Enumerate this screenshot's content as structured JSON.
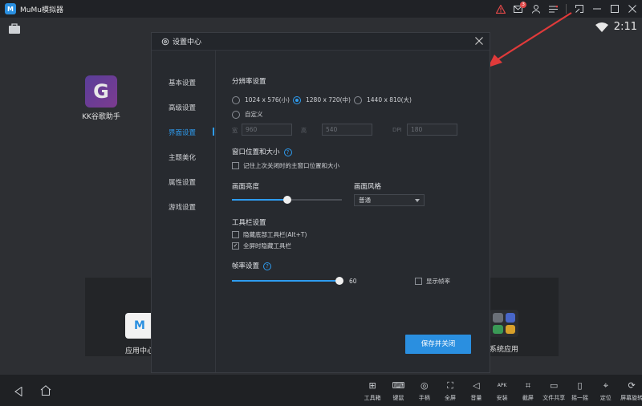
{
  "window": {
    "title": "MuMu模拟器",
    "logo_text": "M",
    "notification_count": "3"
  },
  "statusbar": {
    "time": "2:11"
  },
  "desktop": {
    "kk_app": {
      "label": "KK谷歌助手",
      "icon_letter": "G"
    },
    "app_center": {
      "label": "应用中心",
      "icon_letter": "M"
    },
    "system_apps": {
      "label": "系统应用"
    }
  },
  "bottom_tools": [
    {
      "icon": "toolbox-icon",
      "glyph": "⊞",
      "label": "工具箱"
    },
    {
      "icon": "keyboard-icon",
      "glyph": "⌨",
      "label": "键鼠"
    },
    {
      "icon": "gamepad-icon",
      "glyph": "◎",
      "label": "手柄"
    },
    {
      "icon": "fullscreen-icon",
      "glyph": "⛶",
      "label": "全屏"
    },
    {
      "icon": "volume-icon",
      "glyph": "◁",
      "label": "音量"
    },
    {
      "icon": "apk-install-icon",
      "glyph": "APK",
      "label": "安装"
    },
    {
      "icon": "crop-screenshot-icon",
      "glyph": "⌗",
      "label": "截屏"
    },
    {
      "icon": "folder-share-icon",
      "glyph": "▭",
      "label": "文件共享"
    },
    {
      "icon": "shake-icon",
      "glyph": "▯",
      "label": "摇一摇"
    },
    {
      "icon": "location-icon",
      "glyph": "⌖",
      "label": "定位"
    },
    {
      "icon": "rotate-icon",
      "glyph": "⟳",
      "label": "屏幕旋转"
    }
  ],
  "dialog": {
    "title": "设置中心",
    "nav": [
      "基本设置",
      "高级设置",
      "界面设置",
      "主题美化",
      "属性设置",
      "游戏设置"
    ],
    "active_nav": "界面设置",
    "resolution": {
      "title": "分辨率设置",
      "options": [
        "1024 x 576(小)",
        "1280 x 720(中)",
        "1440 x 810(大)"
      ],
      "selected": "1280 x 720(中)",
      "custom_label": "自定义",
      "width_label": "宽",
      "width_value": "960",
      "height_label": "高",
      "height_value": "540",
      "dpi_label": "DPI",
      "dpi_value": "180"
    },
    "window_pos": {
      "title": "窗口位置和大小",
      "remember_label": "记住上次关闭时的主窗口位置和大小",
      "remember_checked": false
    },
    "brightness": {
      "title": "画面亮度",
      "level": 0.5
    },
    "style": {
      "title": "画面风格",
      "value": "普通"
    },
    "toolbar": {
      "title": "工具栏设置",
      "hide_bottom_label": "隐藏底部工具栏(Alt+T)",
      "hide_bottom_checked": false,
      "fullscreen_hide_label": "全屏时隐藏工具栏",
      "fullscreen_hide_checked": true
    },
    "fps": {
      "title": "帧率设置",
      "value": "60",
      "level": 1.0,
      "show_fps_label": "显示帧率",
      "show_fps_checked": false
    },
    "save_label": "保存并关闭"
  }
}
